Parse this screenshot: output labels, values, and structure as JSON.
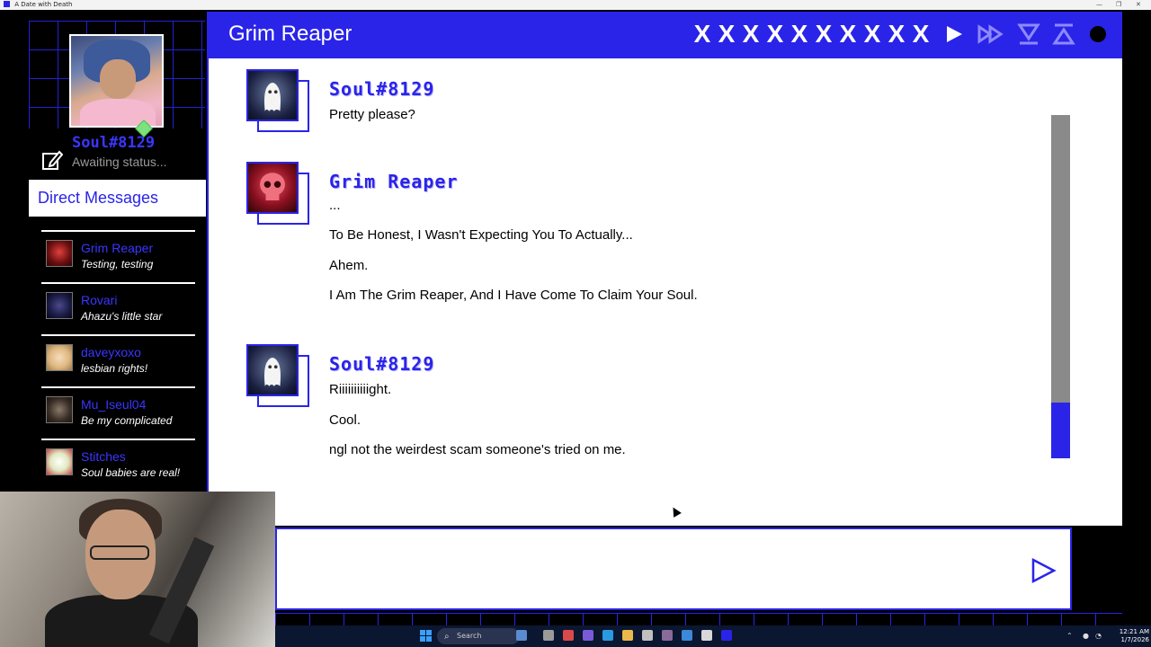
{
  "window": {
    "title": "A Date with Death"
  },
  "profile": {
    "username": "Soul#8129",
    "status": "Awaiting status..."
  },
  "sidebar": {
    "dm_header": "Direct Messages",
    "items": [
      {
        "name": "Grim Reaper",
        "status": "Testing, testing",
        "color": "#8a1a1a"
      },
      {
        "name": "Rovari",
        "status": "Ahazu's little star",
        "color": "#1a1a44"
      },
      {
        "name": "daveyxoxo",
        "status": "lesbian rights!",
        "color": "#e8c9a0"
      },
      {
        "name": "Mu_Iseul04",
        "status": "Be my complicated",
        "color": "#4a3a30"
      },
      {
        "name": "Stitches",
        "status": "Soul babies are real!",
        "color": "#d8e0c0"
      }
    ]
  },
  "chat": {
    "title": "Grim Reaper",
    "header_buttons": [
      "X",
      "X",
      "X",
      "X",
      "X",
      "X",
      "X",
      "X",
      "X",
      "X"
    ],
    "messages": [
      {
        "author": "Soul#8129",
        "avatar": "ghost-icon",
        "lines": [
          "Pretty please?"
        ]
      },
      {
        "author": "Grim Reaper",
        "avatar": "skull-icon",
        "lines": [
          "...",
          "To Be Honest, I Wasn't Expecting You To Actually...",
          "Ahem.",
          "I Am The Grim Reaper, And I Have Come To Claim Your Soul."
        ]
      },
      {
        "author": "Soul#8129",
        "avatar": "ghost-icon",
        "lines": [
          "Riiiiiiiiiight.",
          "Cool.",
          "ngl not the weirdest scam someone's tried on me."
        ]
      }
    ]
  },
  "input": {
    "placeholder": ""
  },
  "taskbar": {
    "search": "Search",
    "time": "12:21 AM",
    "date": "1/7/2026"
  },
  "colors": {
    "accent": "#2a24e8",
    "scroll_track": "#8a8a8a"
  }
}
